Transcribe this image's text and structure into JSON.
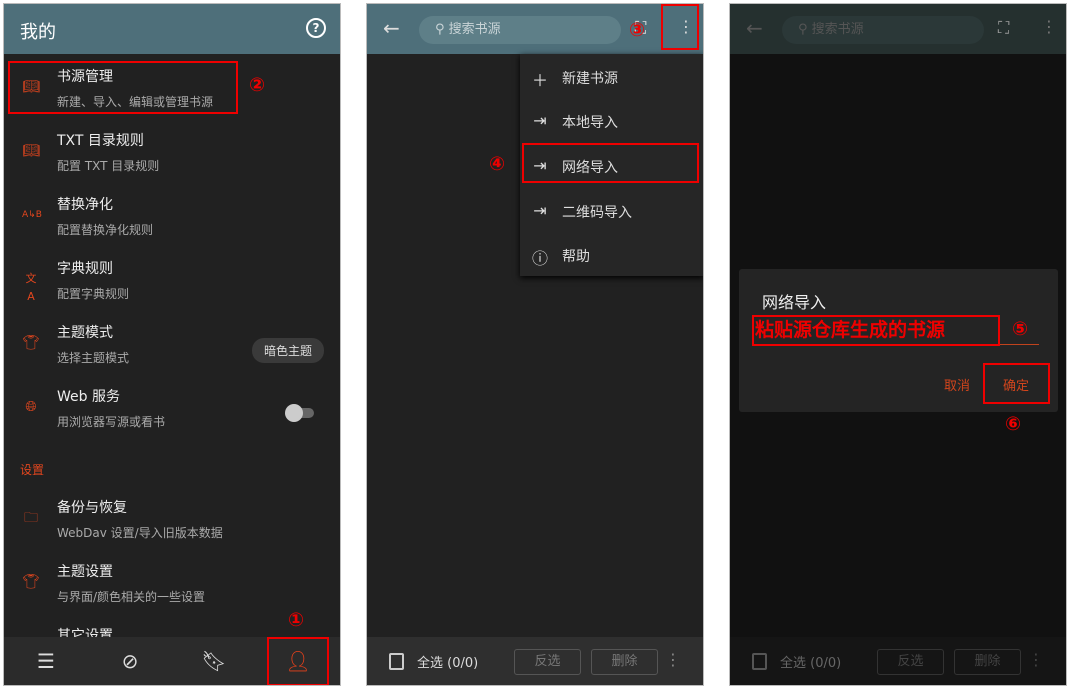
{
  "panel1": {
    "title": "我的",
    "help_icon": "help-circle-icon",
    "items": [
      {
        "title": "书源管理",
        "subtitle": "新建、导入、编辑或管理书源",
        "icon": "book-open-icon"
      },
      {
        "title": "TXT 目录规则",
        "subtitle": "配置 TXT 目录规则",
        "icon": "book-open-icon"
      },
      {
        "title": "替换净化",
        "subtitle": "配置替换净化规则",
        "icon": "replace-ab-icon"
      },
      {
        "title": "字典规则",
        "subtitle": "配置字典规则",
        "icon": "translate-icon"
      },
      {
        "title": "主题模式",
        "subtitle": "选择主题模式",
        "icon": "shirt-icon",
        "chip": "暗色主题"
      },
      {
        "title": "Web 服务",
        "subtitle": "用浏览器写源或看书",
        "icon": "globe-icon",
        "toggle": false
      }
    ],
    "section": "设置",
    "settings": [
      {
        "title": "备份与恢复",
        "subtitle": "WebDav 设置/导入旧版本数据",
        "icon": "folder-icon"
      },
      {
        "title": "主题设置",
        "subtitle": "与界面/颜色相关的一些设置",
        "icon": "shirt-icon"
      },
      {
        "title": "其它设置"
      }
    ],
    "nav": [
      "bookshelf-icon",
      "explore-compass-icon",
      "rss-bookmark-icon",
      "profile-person-icon"
    ],
    "active_nav": 3
  },
  "panel2": {
    "search_placeholder": "搜索书源",
    "menu": [
      {
        "label": "新建书源",
        "icon": "plus-icon"
      },
      {
        "label": "本地导入",
        "icon": "import-icon"
      },
      {
        "label": "网络导入",
        "icon": "import-icon"
      },
      {
        "label": "二维码导入",
        "icon": "import-icon"
      },
      {
        "label": "帮助",
        "icon": "help-circle-icon"
      }
    ]
  },
  "bottom": {
    "select_all": "全选 (0/0)",
    "invert": "反选",
    "delete": "删除"
  },
  "panel3": {
    "search_placeholder": "搜索书源",
    "dialog": {
      "title": "网络导入",
      "input_annotation": "粘贴源仓库生成的书源",
      "cancel": "取消",
      "ok": "确定"
    }
  },
  "annotations": {
    "n1": "①",
    "n2": "②",
    "n3": "③",
    "n4": "④",
    "n5": "⑤",
    "n6": "⑥"
  },
  "colors": {
    "accent": "#e2461e",
    "header": "#4e6f7a",
    "annotation": "#ee0000"
  }
}
